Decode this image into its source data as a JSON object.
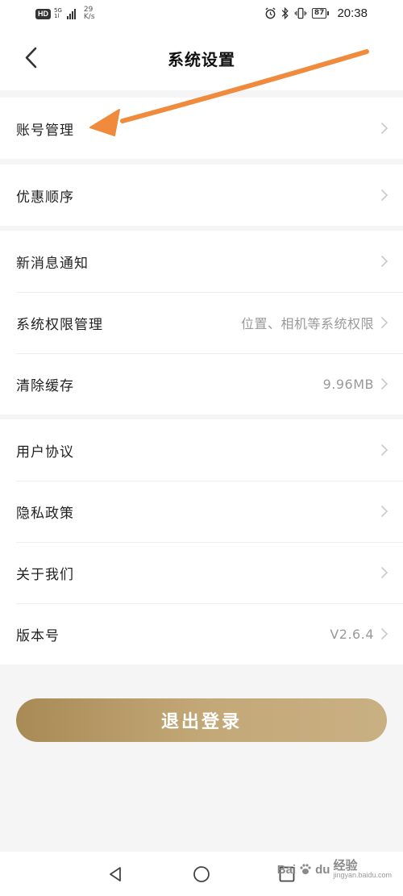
{
  "status_bar": {
    "hd": "HD",
    "network_type": "5G",
    "network_sub": "1l",
    "speed_value": "29",
    "speed_unit": "K/s",
    "battery": "87",
    "time": "20:38"
  },
  "header": {
    "title": "系统设置"
  },
  "groups": [
    {
      "items": [
        {
          "label": "账号管理",
          "value": ""
        }
      ]
    },
    {
      "items": [
        {
          "label": "优惠顺序",
          "value": ""
        }
      ]
    },
    {
      "items": [
        {
          "label": "新消息通知",
          "value": ""
        },
        {
          "label": "系统权限管理",
          "value": "位置、相机等系统权限"
        },
        {
          "label": "清除缓存",
          "value": "9.96MB"
        }
      ]
    },
    {
      "items": [
        {
          "label": "用户协议",
          "value": ""
        },
        {
          "label": "隐私政策",
          "value": ""
        },
        {
          "label": "关于我们",
          "value": ""
        },
        {
          "label": "版本号",
          "value": "V2.6.4"
        }
      ]
    }
  ],
  "logout": {
    "label": "退出登录"
  },
  "watermark": {
    "brand": "Bai",
    "du": "du",
    "jingyan": "经验",
    "url": "jingyan.baidu.com"
  },
  "icons": {
    "back": "chevron-left-icon",
    "row_arrow": "chevron-right-icon",
    "nav_back": "triangle-back-icon",
    "nav_home": "circle-home-icon",
    "nav_recent": "square-recent-icon"
  },
  "colors": {
    "accent_gold": "#b89a66",
    "annotation_orange": "#f08a3c"
  }
}
